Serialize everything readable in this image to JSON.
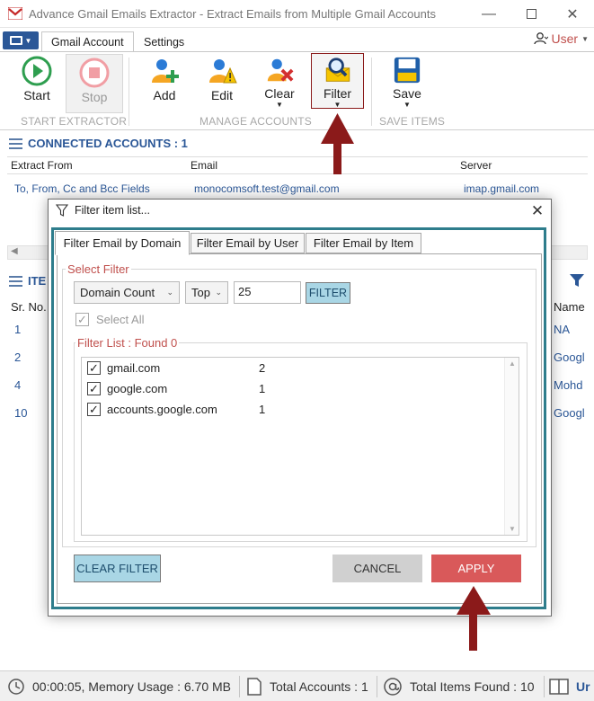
{
  "window": {
    "title": "Advance Gmail Emails Extractor - Extract Emails from Multiple Gmail Accounts",
    "minimize_icon": "minimize-icon",
    "maximize_icon": "maximize-icon",
    "close_icon": "close-icon"
  },
  "ribbon_tabs": {
    "active": "Gmail Account",
    "other": "Settings",
    "user_label": "User"
  },
  "ribbon": {
    "start": "Start",
    "stop": "Stop",
    "start_group": "START EXTRACTOR",
    "add": "Add",
    "edit": "Edit",
    "clear": "Clear",
    "filter": "Filter",
    "manage_group": "MANAGE ACCOUNTS",
    "save": "Save",
    "save_group": "SAVE ITEMS"
  },
  "connected": {
    "heading": "CONNECTED ACCOUNTS : 1",
    "columns": [
      "Extract From",
      "Email",
      "Server"
    ],
    "rows": [
      [
        "To, From, Cc and Bcc Fields",
        "monocomsoft.test@gmail.com",
        "imap.gmail.com"
      ]
    ]
  },
  "items": {
    "heading_partial": "ITE",
    "col_srno": "Sr. No.",
    "col_name": "Name",
    "srnos": [
      "1",
      "2",
      "4",
      "10"
    ],
    "names": [
      "NA",
      "Googl",
      "Mohd",
      "Googl"
    ]
  },
  "status": {
    "timer": "00:00:05, Memory Usage : 6.70 MB",
    "accounts": "Total Accounts : 1",
    "items_found": "Total Items Found : 10",
    "extra": "Ur"
  },
  "dialog": {
    "title": "Filter item list...",
    "tabs": [
      "Filter Email by Domain",
      "Filter Email by User",
      "Filter Email by Item"
    ],
    "select_filter_label": "Select Filter",
    "filter_type": "Domain Count",
    "filter_order": "Top",
    "filter_value": "25",
    "filter_button": "FILTER",
    "select_all": "Select All",
    "filter_list_label": "Filter List : Found 0",
    "entries": [
      {
        "domain": "gmail.com",
        "count": "2"
      },
      {
        "domain": "google.com",
        "count": "1"
      },
      {
        "domain": "accounts.google.com",
        "count": "1"
      }
    ],
    "clear_filter": "CLEAR FILTER",
    "cancel": "CANCEL",
    "apply": "APPLY"
  },
  "colors": {
    "accent_blue": "#2b5797",
    "highlight_red": "#8b1a1a",
    "apply_red": "#d9595a",
    "dialog_border_teal": "#2e7d8c",
    "filter_button_teal": "#a9d6e5"
  }
}
